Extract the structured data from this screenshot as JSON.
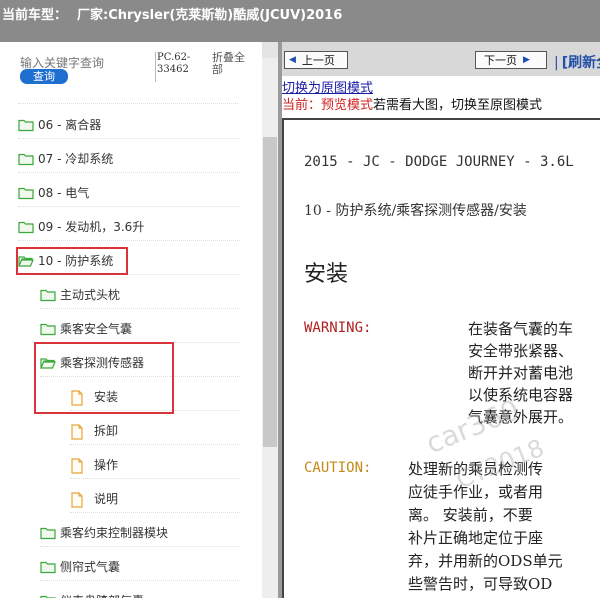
{
  "titlebar": {
    "label": "当前车型：",
    "maker": "厂家:Chrysler(克莱斯勒)酷威(JCUV)2016"
  },
  "search": {
    "placeholder": "输入关键字查询",
    "button": "查询",
    "pc_code": "PC.62-33462",
    "collapse_all": "折叠全部"
  },
  "tree": [
    {
      "label": "06 - 离合器",
      "indent": 0,
      "kind": "folder"
    },
    {
      "label": "07 - 冷却系统",
      "indent": 0,
      "kind": "folder"
    },
    {
      "label": "08 - 电气",
      "indent": 0,
      "kind": "folder"
    },
    {
      "label": "09 - 发动机，3.6升",
      "indent": 0,
      "kind": "folder"
    },
    {
      "label": "10 - 防护系统",
      "indent": 0,
      "kind": "folder-open"
    },
    {
      "label": "主动式头枕",
      "indent": 1,
      "kind": "folder"
    },
    {
      "label": "乘客安全气囊",
      "indent": 1,
      "kind": "folder"
    },
    {
      "label": "乘客探测传感器",
      "indent": 1,
      "kind": "folder-open"
    },
    {
      "label": "安装",
      "indent": 2,
      "kind": "doc"
    },
    {
      "label": "拆卸",
      "indent": 2,
      "kind": "doc"
    },
    {
      "label": "操作",
      "indent": 2,
      "kind": "doc"
    },
    {
      "label": "说明",
      "indent": 2,
      "kind": "doc"
    },
    {
      "label": "乘客约束控制器模块",
      "indent": 1,
      "kind": "folder"
    },
    {
      "label": "侧帘式气囊",
      "indent": 1,
      "kind": "folder"
    },
    {
      "label": "仪表盘膝部气囊",
      "indent": 1,
      "kind": "folder"
    }
  ],
  "nav": {
    "prev": "上一页",
    "next": "下一页",
    "refresh": "[刷新全",
    "prev_icon": "arrow-left-icon",
    "next_icon": "arrow-right-icon"
  },
  "notice": {
    "switch_link": "切换为原图模式",
    "preview_red": "当前：预览模式",
    "preview_rest": "若需看大图，切换至原图模式"
  },
  "doc": {
    "header1": "2015 - JC - DODGE JOURNEY - 3.6L",
    "header2": "10 - 防护系统/乘客探测传感器/安装",
    "title": "安装",
    "warning_label": "WARNING:",
    "warning_lines": [
      "在装备气囊的车",
      "安全带张紧器、",
      "断开并对蓄电池",
      "以使系统电容器",
      "气囊意外展开。"
    ],
    "caution_label": "CAUTION:",
    "caution_lines": [
      "处理新的乘员检测传",
      "应徒手作业，或者用",
      "离。 安装前，不要",
      "补片正确地定位于座",
      "弃，并用新的ODS单元",
      "些警告时，可导致OD"
    ],
    "watermark1": "car360",
    "watermark2": "CY2018"
  },
  "colors": {
    "highlight": "#d9343a",
    "folder": "#3aa83a",
    "doc_icon": "#e8a53a"
  }
}
